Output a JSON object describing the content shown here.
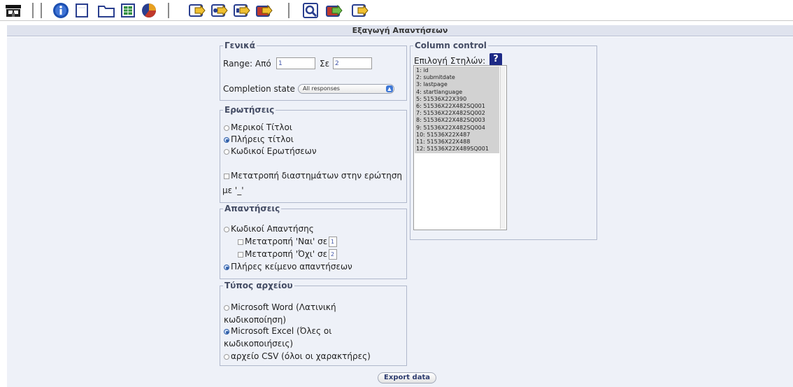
{
  "header": {
    "title": "Εξαγωγή Απαντήσεων"
  },
  "toolbar": {
    "icons": [
      "home-icon",
      "info-icon",
      "blank-page-icon",
      "folder-icon",
      "spreadsheet-icon",
      "pie-chart-icon",
      "export-arrow-icon",
      "export-arrow-icon",
      "export-arrow-icon",
      "export-arrow-icon",
      "search-icon",
      "export-arrow-icon",
      "export-arrow-icon"
    ]
  },
  "general": {
    "legend": "Γενικά",
    "range_label": "Range: Από",
    "from_value": "1",
    "to_label": "Σε",
    "to_value": "2",
    "completion_label": "Completion state",
    "completion_selected": "All responses"
  },
  "questions": {
    "legend": "Ερωτήσεις",
    "option_partial": "Μερικοί Τίτλοι",
    "option_full": "Πλήρεις τίτλοι",
    "option_codes": "Κωδικοί Ερωτήσεων",
    "convert_spaces_line1": "Μετατροπή διαστημάτων στην ερώτηση",
    "convert_spaces_line2": "με '_'"
  },
  "answers": {
    "legend": "Απαντήσεις",
    "option_codes": "Κωδικοί Απαντήσης",
    "convert_yes_label": "Μετατροπή 'Ναι' σε",
    "convert_yes_value": "1",
    "convert_no_label": "Μετατροπή 'Όχι' σε",
    "convert_no_value": "2",
    "option_full_text": "Πλήρες κείμενο απαντήσεων"
  },
  "filetype": {
    "legend": "Τύπος αρχείου",
    "word_line1": "Microsoft Word (Λατινική",
    "word_line2": "κωδικοποίηση)",
    "excel_line1": "Microsoft Excel (Όλες οι",
    "excel_line2": "κωδικοποιήσεις)",
    "csv": "αρχείο CSV (όλοι οι χαρακτήρες)"
  },
  "columns": {
    "legend": "Column control",
    "choose_label": "Επιλογή Στηλών:",
    "help_glyph": "?",
    "items": [
      "1: id",
      "2: submitdate",
      "3: lastpage",
      "4: startlanguage",
      "5: 51536X22X390",
      "6: 51536X22X482SQ001",
      "7: 51536X22X482SQ002",
      "8: 51536X22X482SQ003",
      "9: 51536X22X482SQ004",
      "10: 51536X22X487",
      "11: 51536X22X488",
      "12: 51536X22X489SQ001"
    ]
  },
  "footer": {
    "export_label": "Export data"
  },
  "colors": {
    "panel_bg": "#eef1f8",
    "header_bg": "#dfe3ee",
    "border": "#b0b8cc",
    "legend": "#444c64",
    "selected": "#d2d2d2"
  }
}
